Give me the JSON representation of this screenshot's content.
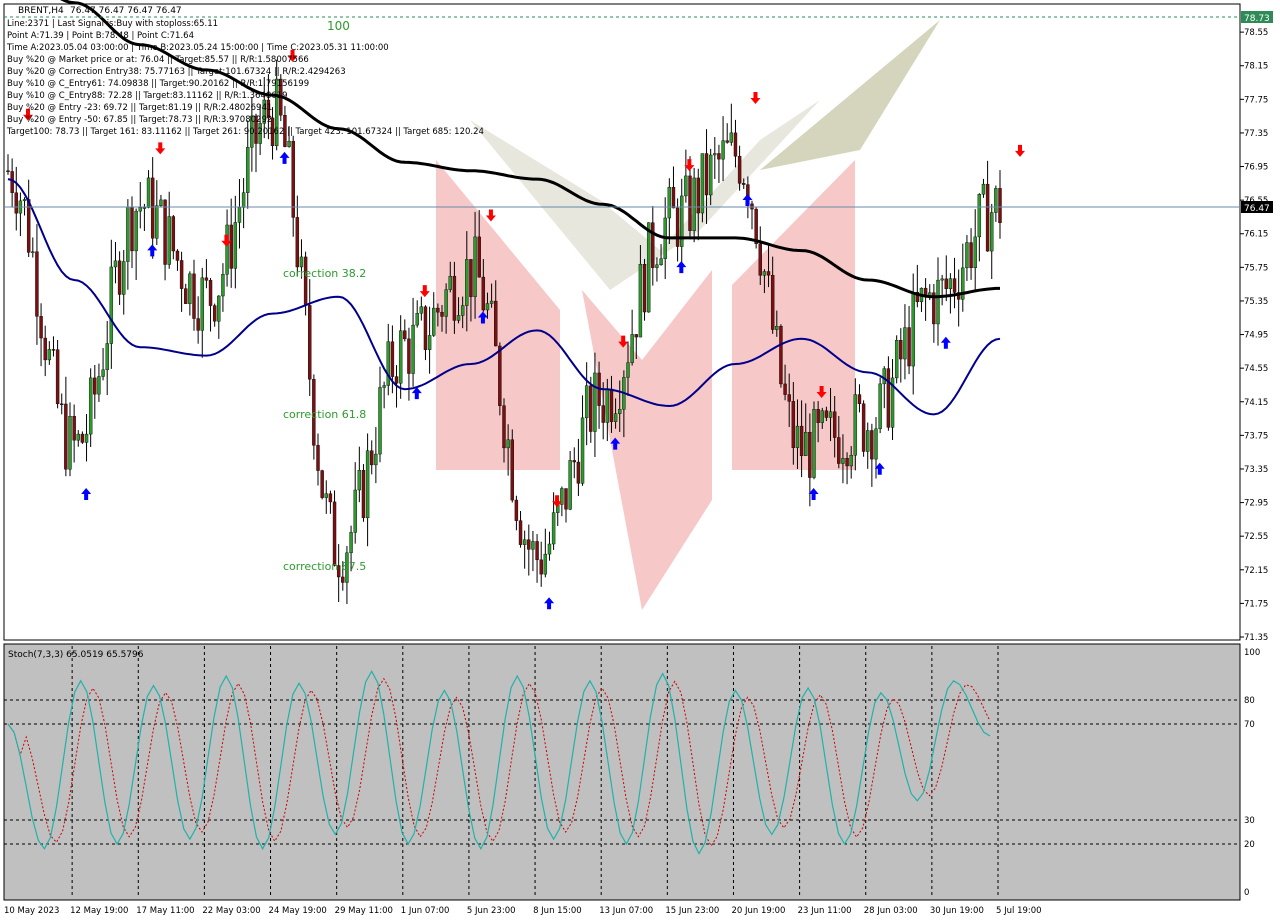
{
  "header": {
    "symbol": "BRENT,H4",
    "ohlc": "76.47 76.47 76.47 76.47"
  },
  "info_lines": [
    "Line:2371 | Last Signal is:Buy with stoploss:65.11",
    "Point A:71.39 | Point B:78.48 | Point C:71.64",
    "Time A:2023.05.04 03:00:00 | Time B:2023.05.24 15:00:00 | Time C:2023.05.31 11:00:00",
    "Buy %20 @ Market price or at: 76.04 || Target:85.57 || R/R:1.58007566",
    "Buy %20 @ Correction Entry38: 75.77163 || Target:101.67324 || R/R:2.4294263",
    "Buy %10 @ C_Entry61: 74.09838 || Target:90.20162 || R/R:1.79156199",
    "Buy %10 @ C_Entry88: 72.28 || Target:83.11162 || R/R:1.3648619",
    "Buy %20 @ Entry -23: 69.72 || Target:81.19 || R/R:2.48026941",
    "Buy %20 @ Entry -50: 67.85 || Target:78.73 || R/R:3.97080292",
    "Target100: 78.73 || Target 161: 83.11162 || Target 261: 90.20162 || Target 423: 101.67324 || Target 685: 120.24"
  ],
  "annotations": {
    "level100": "100",
    "corr38": "correction 38.2",
    "corr61": "correction 61.8",
    "corr87": "correction 87.5"
  },
  "price_badges": {
    "target": "78.73",
    "current": "76.47"
  },
  "stoch_label": "Stoch(7,3,3) 65.0519 65.5796",
  "colors": {
    "bull": "#2e9a2e",
    "bear": "#7a1010",
    "ma_black": "#000000",
    "ma_blue": "#00008b",
    "stoch_main": "#20b2aa",
    "stoch_signal": "#cc0000",
    "buy_arrow": "#0000ff",
    "sell_arrow": "#ff0000",
    "badge_green": "#2e8b57",
    "current_line": "#6a8aa8"
  },
  "chart_data": {
    "type": "line",
    "title": "BRENT,H4",
    "price_axis": {
      "min": 71.35,
      "max": 78.73,
      "ticks": [
        "78.55",
        "78.15",
        "77.75",
        "77.35",
        "76.95",
        "76.55",
        "76.15",
        "75.75",
        "75.35",
        "74.95",
        "74.55",
        "74.15",
        "73.75",
        "73.35",
        "72.95",
        "72.55",
        "72.15",
        "71.75",
        "71.35"
      ]
    },
    "x_tick_labels": [
      "10 May 2023",
      "12 May 19:00",
      "17 May 11:00",
      "22 May 03:00",
      "24 May 19:00",
      "29 May 11:00",
      "1 Jun 07:00",
      "5 Jun 23:00",
      "8 Jun 15:00",
      "13 Jun 07:00",
      "15 Jun 23:00",
      "20 Jun 19:00",
      "23 Jun 11:00",
      "28 Jun 03:00",
      "30 Jun 19:00",
      "5 Jul 19:00"
    ],
    "series": [
      {
        "name": "",
        "kind": "close",
        "x": [
          "10 May 2023",
          "12 May 19:00",
          "17 May 11:00",
          "22 May 03:00",
          "24 May 19:00",
          "29 May 11:00",
          "1 Jun 07:00",
          "5 Jun 23:00",
          "8 Jun 15:00",
          "13 Jun 07:00",
          "15 Jun 23:00",
          "20 Jun 19:00",
          "23 Jun 11:00",
          "28 Jun 03:00",
          "30 Jun 19:00",
          "5 Jul 19:00"
        ],
        "values": [
          76.9,
          73.6,
          76.5,
          75.4,
          77.6,
          72.4,
          74.8,
          75.7,
          72.3,
          74.2,
          76.3,
          77.1,
          73.6,
          73.9,
          75.4,
          76.47
        ]
      },
      {
        "name": "",
        "kind": "ma_slow",
        "x": [
          "10 May 2023",
          "12 May 19:00",
          "17 May 11:00",
          "22 May 03:00",
          "24 May 19:00",
          "29 May 11:00",
          "1 Jun 07:00",
          "5 Jun 23:00",
          "8 Jun 15:00",
          "13 Jun 07:00",
          "15 Jun 23:00",
          "20 Jun 19:00",
          "23 Jun 11:00",
          "28 Jun 03:00",
          "30 Jun 19:00",
          "5 Jul 19:00"
        ],
        "values": [
          79.4,
          78.9,
          78.4,
          78.1,
          77.8,
          77.4,
          77.0,
          76.9,
          76.8,
          76.5,
          76.1,
          76.1,
          75.95,
          75.6,
          75.4,
          75.5
        ]
      },
      {
        "name": "",
        "kind": "ma_fast",
        "x": [
          "10 May 2023",
          "12 May 19:00",
          "17 May 11:00",
          "22 May 03:00",
          "24 May 19:00",
          "29 May 11:00",
          "1 Jun 07:00",
          "5 Jun 23:00",
          "8 Jun 15:00",
          "13 Jun 07:00",
          "15 Jun 23:00",
          "20 Jun 19:00",
          "23 Jun 11:00",
          "28 Jun 03:00",
          "30 Jun 19:00",
          "5 Jul 19:00"
        ],
        "values": [
          76.8,
          75.6,
          74.8,
          74.7,
          75.2,
          75.4,
          74.3,
          74.6,
          75.0,
          74.3,
          74.1,
          74.6,
          74.9,
          74.5,
          74.0,
          74.9
        ]
      }
    ],
    "buy_arrows_x": [
      "12 May 19:00",
      "17 May 11:00",
      "24 May 19:00",
      "1 Jun 07:00",
      "5 Jun 23:00",
      "8 Jun 15:00",
      "13 Jun 07:00",
      "15 Jun 23:00",
      "20 Jun 19:00",
      "23 Jun 11:00",
      "28 Jun 03:00",
      "30 Jun 19:00"
    ],
    "sell_arrows_x": [
      "10 May 2023",
      "17 May 11:00",
      "22 May 03:00",
      "24 May 19:00",
      "1 Jun 07:00",
      "5 Jun 23:00",
      "8 Jun 15:00",
      "13 Jun 07:00",
      "15 Jun 23:00",
      "20 Jun 19:00",
      "23 Jun 11:00",
      "5 Jul 19:00"
    ],
    "stochastic": {
      "name": "Stoch(7,3,3)",
      "main": 65.0519,
      "signal": 65.5796,
      "levels": [
        100,
        80,
        70,
        30,
        20,
        0
      ],
      "axis_labels": [
        "100",
        "80",
        "70",
        "30",
        "20",
        "0"
      ],
      "values": [
        70,
        18,
        88,
        20,
        86,
        22,
        90,
        18,
        87,
        24,
        92,
        20,
        84,
        18,
        90,
        22,
        88,
        20,
        91,
        16,
        84,
        24,
        85,
        20,
        83,
        38,
        88,
        65
      ]
    }
  }
}
